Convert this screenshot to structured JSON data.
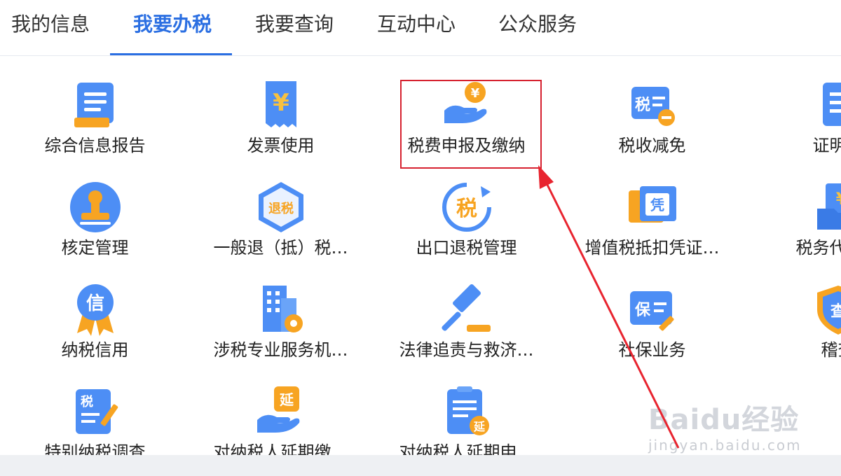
{
  "nav": {
    "tabs": [
      {
        "label": "我的信息",
        "active": false
      },
      {
        "label": "我要办税",
        "active": true
      },
      {
        "label": "我要查询",
        "active": false
      },
      {
        "label": "互动中心",
        "active": false
      },
      {
        "label": "公众服务",
        "active": false
      }
    ]
  },
  "grid": {
    "rows": [
      [
        {
          "label": "综合信息报告",
          "icon": "report-scroll-icon"
        },
        {
          "label": "发票使用",
          "icon": "invoice-yuan-icon"
        },
        {
          "label": "税费申报及缴纳",
          "icon": "hand-coin-icon"
        },
        {
          "label": "税收减免",
          "icon": "tax-minus-icon"
        },
        {
          "label": "证明开",
          "icon": "certificate-icon"
        }
      ],
      [
        {
          "label": "核定管理",
          "icon": "stamp-icon"
        },
        {
          "label": "一般退（抵）税…",
          "icon": "hexagon-refund-icon"
        },
        {
          "label": "出口退税管理",
          "icon": "circular-tax-icon"
        },
        {
          "label": "增值税抵扣凭证…",
          "icon": "voucher-ticket-icon"
        },
        {
          "label": "税务代保管",
          "icon": "folder-yuan-icon"
        }
      ],
      [
        {
          "label": "纳税信用",
          "icon": "credit-medal-icon"
        },
        {
          "label": "涉税专业服务机…",
          "icon": "building-gear-icon"
        },
        {
          "label": "法律追责与救济…",
          "icon": "gavel-icon"
        },
        {
          "label": "社保业务",
          "icon": "social-security-card-icon"
        },
        {
          "label": "稽查",
          "icon": "shield-check-icon"
        }
      ],
      [
        {
          "label": "特别纳税调查",
          "icon": "tax-document-pen-icon"
        },
        {
          "label": "对纳税人延期缴…",
          "icon": "hand-delay-icon"
        },
        {
          "label": "对纳税人延期申…",
          "icon": "clipboard-delay-icon"
        }
      ]
    ],
    "icon_glyphs": {
      "yuan": "¥",
      "tax": "税",
      "refund": "退税",
      "voucher": "凭",
      "credit": "信",
      "bao": "保",
      "check": "查",
      "delay": "延"
    }
  },
  "watermark": {
    "brand": "Baidu经验",
    "url": "jingyan.baidu.com"
  },
  "colors": {
    "accent": "#2b6fe2",
    "highlight": "#d6212f",
    "icon_blue": "#4d8ef5",
    "icon_orange": "#f7a422"
  }
}
